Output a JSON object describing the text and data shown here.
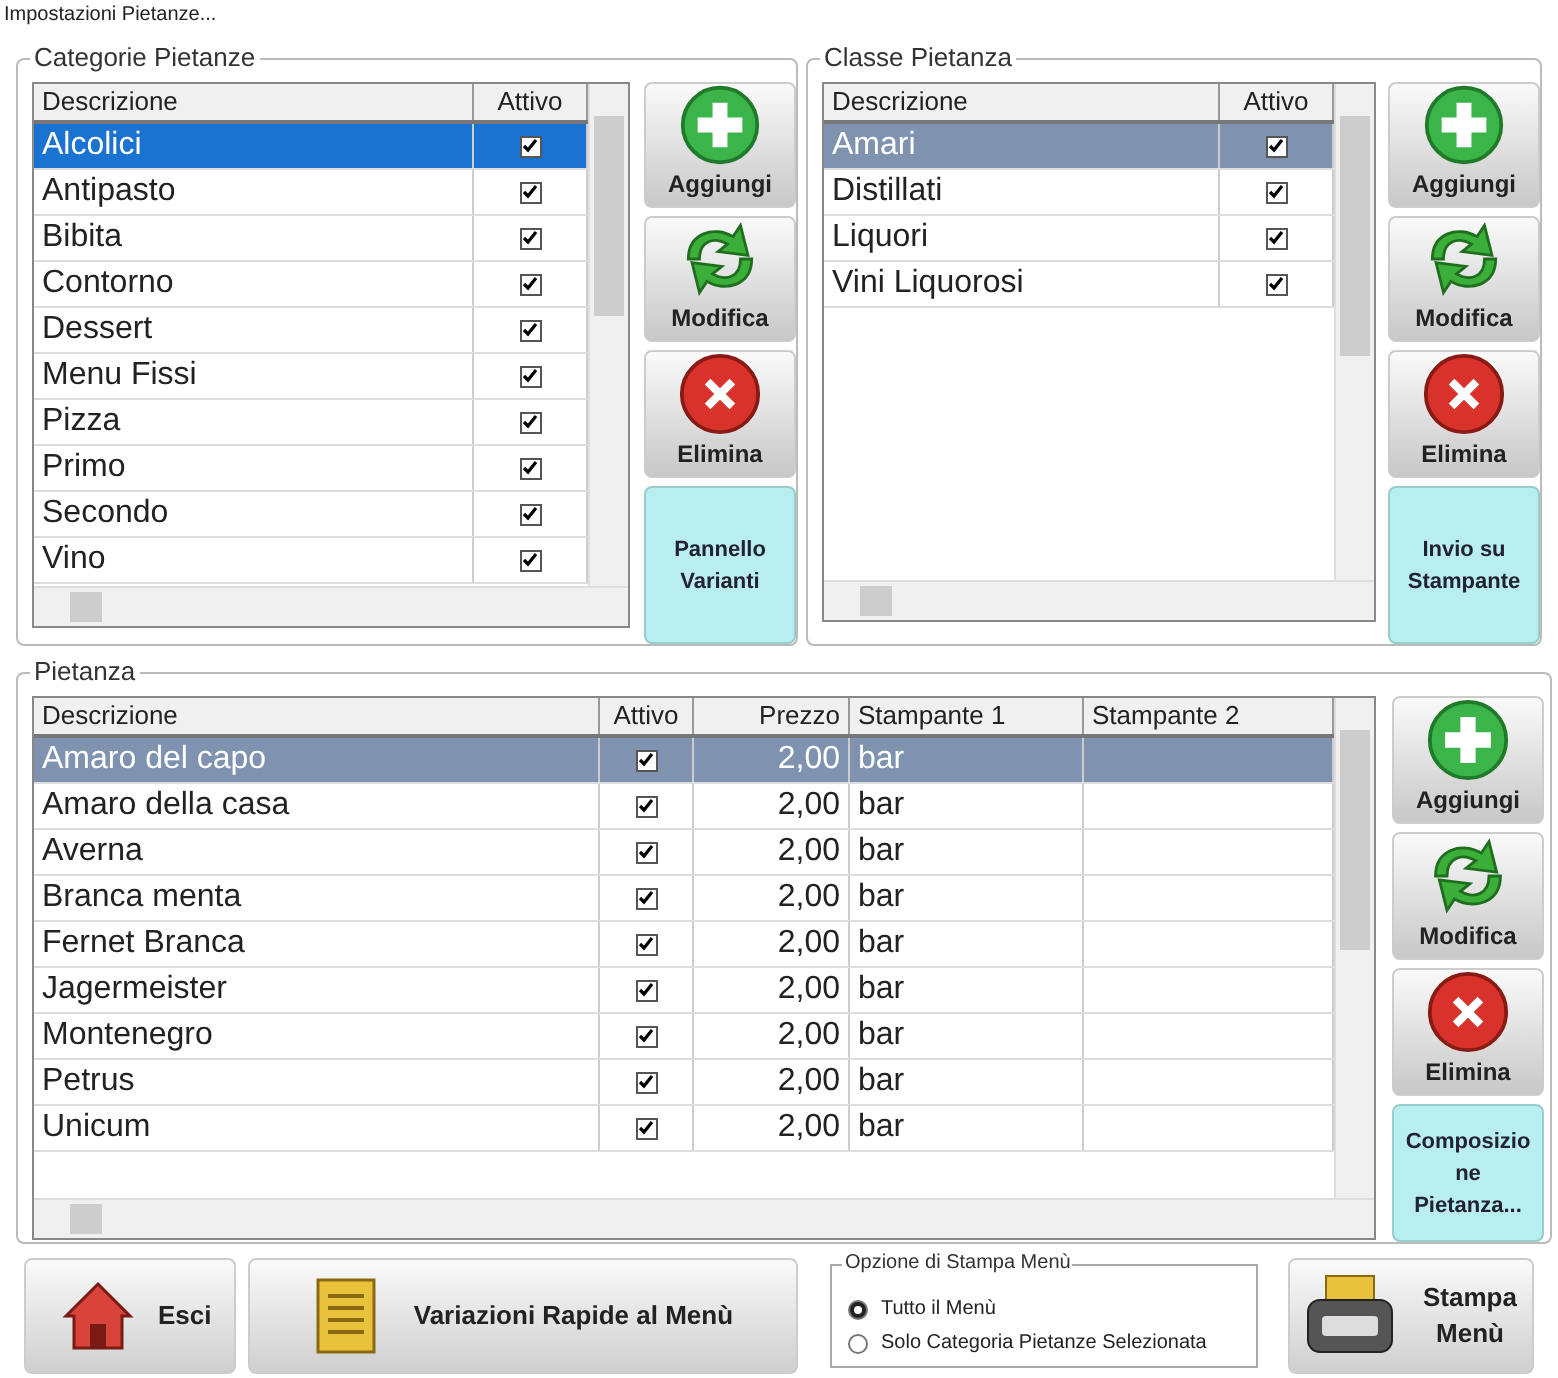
{
  "window": {
    "title": "Impostazioni Pietanze..."
  },
  "categorie": {
    "title": "Categorie Pietanze",
    "columns": [
      "Descrizione",
      "Attivo"
    ],
    "rows": [
      {
        "cells": [
          "Alcolici"
        ],
        "checked": true,
        "selected": true
      },
      {
        "cells": [
          "Antipasto"
        ],
        "checked": true,
        "selected": false
      },
      {
        "cells": [
          "Bibita"
        ],
        "checked": true,
        "selected": false
      },
      {
        "cells": [
          "Contorno"
        ],
        "checked": true,
        "selected": false
      },
      {
        "cells": [
          "Dessert"
        ],
        "checked": true,
        "selected": false
      },
      {
        "cells": [
          "Menu Fissi"
        ],
        "checked": true,
        "selected": false
      },
      {
        "cells": [
          "Pizza"
        ],
        "checked": true,
        "selected": false
      },
      {
        "cells": [
          "Primo"
        ],
        "checked": true,
        "selected": false
      },
      {
        "cells": [
          "Secondo"
        ],
        "checked": true,
        "selected": false
      },
      {
        "cells": [
          "Vino"
        ],
        "checked": true,
        "selected": false
      }
    ],
    "buttons": [
      {
        "kind": "add",
        "label": "Aggiungi"
      },
      {
        "kind": "edit",
        "label": "Modifica"
      },
      {
        "kind": "delete",
        "label": "Elimina"
      },
      {
        "kind": "text",
        "label": "Pannello Varianti"
      }
    ]
  },
  "classe": {
    "title": "Classe Pietanza",
    "columns": [
      "Descrizione",
      "Attivo"
    ],
    "rows": [
      {
        "cells": [
          "Amari"
        ],
        "checked": true,
        "selected": true
      },
      {
        "cells": [
          "Distillati"
        ],
        "checked": true,
        "selected": false
      },
      {
        "cells": [
          "Liquori"
        ],
        "checked": true,
        "selected": false
      },
      {
        "cells": [
          "Vini Liquorosi"
        ],
        "checked": true,
        "selected": false
      }
    ],
    "buttons": [
      {
        "kind": "add",
        "label": "Aggiungi"
      },
      {
        "kind": "edit",
        "label": "Modifica"
      },
      {
        "kind": "delete",
        "label": "Elimina"
      },
      {
        "kind": "text",
        "label": "Invio su Stampante"
      }
    ]
  },
  "pietanza": {
    "title": "Pietanza",
    "columns": [
      "Descrizione",
      "Attivo",
      "Prezzo",
      "Stampante 1",
      "Stampante 2"
    ],
    "rows": [
      {
        "cells": [
          "Amaro del capo",
          "",
          "2,00",
          "bar"
        ],
        "checked": true,
        "selected": true
      },
      {
        "cells": [
          "Amaro della casa",
          "",
          "2,00",
          "bar"
        ],
        "checked": true,
        "selected": false
      },
      {
        "cells": [
          "Averna",
          "",
          "2,00",
          "bar"
        ],
        "checked": true,
        "selected": false
      },
      {
        "cells": [
          "Branca menta",
          "",
          "2,00",
          "bar"
        ],
        "checked": true,
        "selected": false
      },
      {
        "cells": [
          "Fernet Branca",
          "",
          "2,00",
          "bar"
        ],
        "checked": true,
        "selected": false
      },
      {
        "cells": [
          "Jagermeister",
          "",
          "2,00",
          "bar"
        ],
        "checked": true,
        "selected": false
      },
      {
        "cells": [
          "Montenegro",
          "",
          "2,00",
          "bar"
        ],
        "checked": true,
        "selected": false
      },
      {
        "cells": [
          "Petrus",
          "",
          "2,00",
          "bar"
        ],
        "checked": true,
        "selected": false
      },
      {
        "cells": [
          "Unicum",
          "",
          "2,00",
          "bar"
        ],
        "checked": true,
        "selected": false
      }
    ],
    "buttons": [
      {
        "kind": "add",
        "label": "Aggiungi"
      },
      {
        "kind": "edit",
        "label": "Modifica"
      },
      {
        "kind": "delete",
        "label": "Elimina"
      },
      {
        "kind": "text",
        "label": "Composizio ne Pietanza..."
      }
    ]
  },
  "bottom_buttons": [
    {
      "kind": "home",
      "label": "Esci"
    },
    {
      "kind": "scroll",
      "label": "Variazioni Rapide al Menù"
    }
  ],
  "print_options": {
    "title": "Opzione di Stampa Menù",
    "options": [
      {
        "label": "Tutto il Menù",
        "selected": true
      },
      {
        "label": "Solo Categoria Pietanze Selezionata",
        "selected": false
      }
    ]
  },
  "print_button": {
    "kind": "printer",
    "label": "Stampa Menù"
  }
}
